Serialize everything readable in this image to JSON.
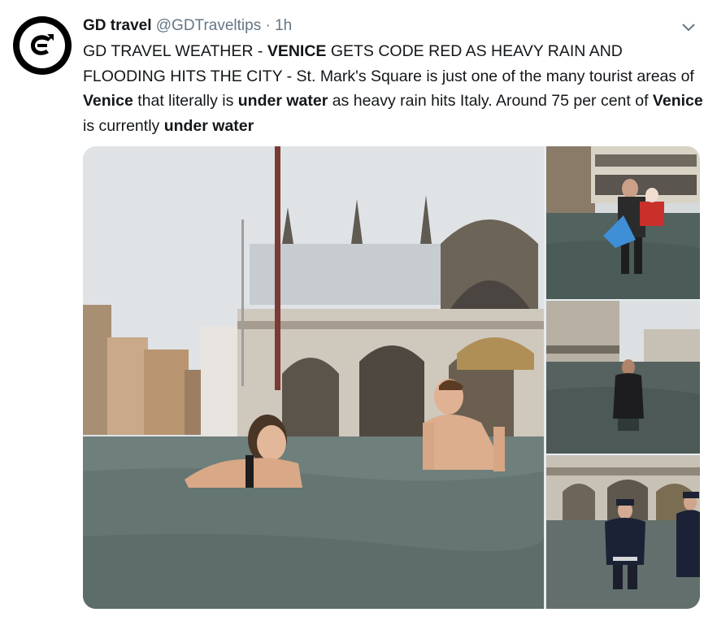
{
  "tweet": {
    "author_name": "GD travel",
    "author_handle": "@GDTraveltips",
    "separator": "·",
    "timestamp": "1h",
    "text_parts": [
      "GD TRAVEL WEATHER - ",
      "VENICE",
      " GETS CODE RED AS HEAVY RAIN AND FLOODING HITS THE CITY - St. Mark's Square is just one of the many tourist areas of ",
      "Venice",
      " that literally is ",
      "under water",
      " as heavy rain hits Italy. Around 75 per cent of ",
      "Venice",
      " is currently ",
      "under water"
    ]
  },
  "icons": {
    "avatar": "gd-travel-logo",
    "menu": "chevron-down-icon"
  },
  "colors": {
    "primary_text": "#14171a",
    "secondary_text": "#657786",
    "background": "#ffffff"
  }
}
